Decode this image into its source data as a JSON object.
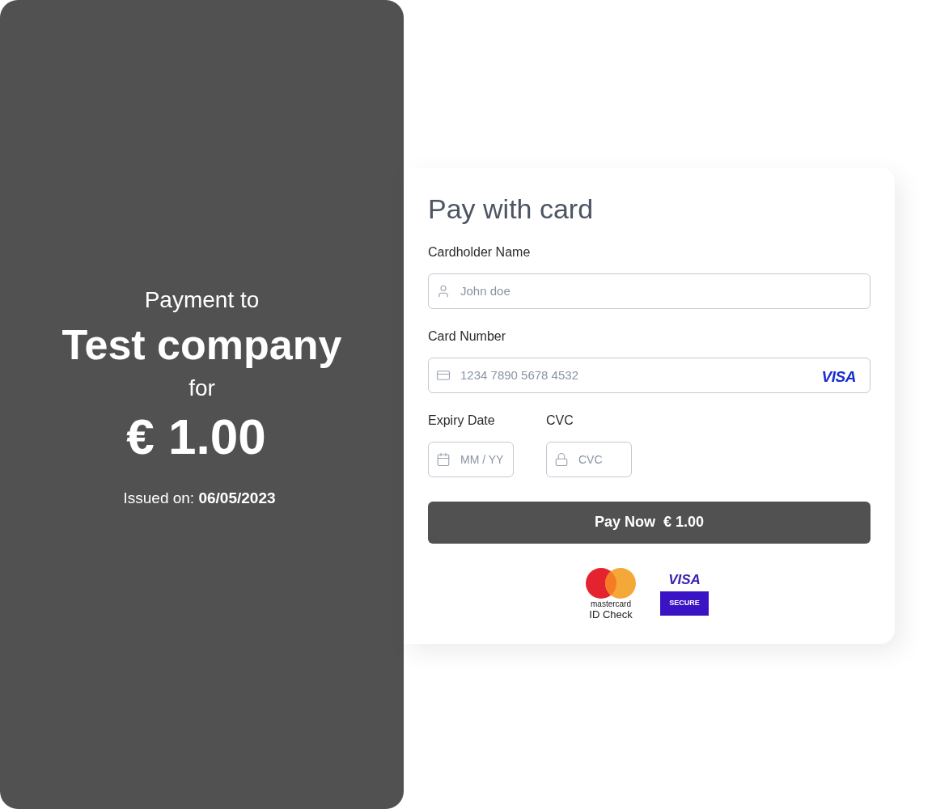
{
  "summary": {
    "intro": "Payment to",
    "company": "Test company",
    "connector": "for",
    "amount": "€ 1.00",
    "issued": "Issued on: **06/05/2023**"
  },
  "card_form": {
    "title": "Pay with card",
    "fields": [
      {
        "label": "Cardholder Name",
        "placeholder": "John doe",
        "kind": "name"
      },
      {
        "label": "Card Number",
        "placeholder": "1234 7890 5678 4532",
        "kind": "card",
        "brand": "VISA"
      }
    ],
    "small_fields": [
      {
        "label": "Expiry Date",
        "placeholder": "MM / YY",
        "kind": "date"
      },
      {
        "label": "CVC",
        "placeholder": "CVC",
        "kind": "lock"
      }
    ],
    "pay_button": {
      "label": "Pay Now",
      "amount": "€ 1.00"
    },
    "badges": {
      "mastercard_name": "mastercard",
      "mastercard_caption": "ID Check",
      "visa_name": "VISA",
      "visa_caption": "SECURE"
    }
  }
}
